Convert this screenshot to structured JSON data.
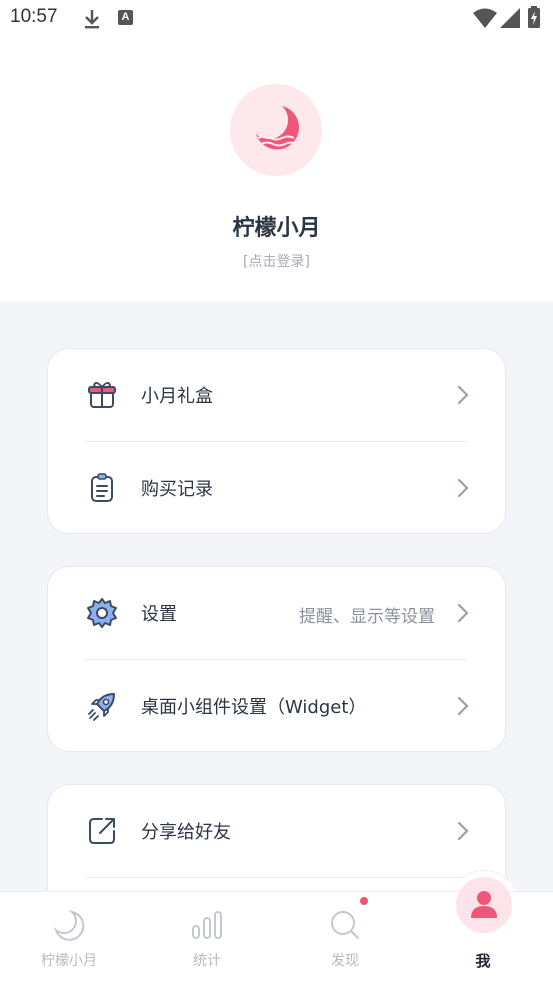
{
  "status_bar": {
    "time": "10:57",
    "notification_icons": [
      "download-icon",
      "a-badge-icon"
    ],
    "system_icons": [
      "wifi-icon",
      "signal-icon",
      "battery-charging-icon"
    ]
  },
  "profile": {
    "app_name": "柠檬小月",
    "login_prompt": "[点击登录]",
    "avatar_icon": "moon-logo-icon"
  },
  "menu_groups": [
    {
      "items": [
        {
          "label": "小月礼盒",
          "icon": "gift-icon"
        },
        {
          "label": "购买记录",
          "icon": "clipboard-icon"
        }
      ]
    },
    {
      "items": [
        {
          "label": "设置",
          "hint": "提醒、显示等设置",
          "icon": "gear-icon"
        },
        {
          "label": "桌面小组件设置（Widget）",
          "icon": "rocket-icon"
        }
      ]
    },
    {
      "items": [
        {
          "label": "分享给好友",
          "icon": "share-icon"
        }
      ]
    }
  ],
  "tab_bar": {
    "tabs": [
      {
        "label": "柠檬小月",
        "icon": "moon-icon"
      },
      {
        "label": "统计",
        "icon": "bars-icon"
      },
      {
        "label": "发现",
        "icon": "search-icon",
        "badge": true
      },
      {
        "label": "我",
        "icon": "person-icon",
        "active": true
      }
    ]
  },
  "colors": {
    "accent": "#f0567a",
    "accent_light": "#fde8ec",
    "icon_stroke": "#3d4a63",
    "icon_fill_blue": "#8ab1ee",
    "background": "#f4f5f9"
  }
}
